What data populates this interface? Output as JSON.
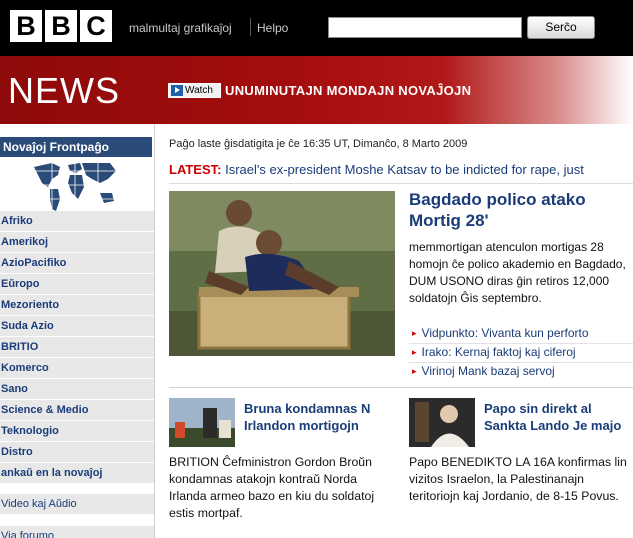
{
  "header": {
    "logo_letters": [
      "B",
      "B",
      "C"
    ],
    "nav": {
      "graphics": "malmultaj grafikaĵoj",
      "help": "Helpo"
    },
    "search": {
      "value": "",
      "button": "Serĉo"
    }
  },
  "banner": {
    "title": "NEWS",
    "watch_label": "Watch",
    "headline": "UNUMINUTAJN MONDAJN NOVAĴOJN",
    "colors": {
      "dark": "#8e0a0a",
      "mid": "#b11818"
    }
  },
  "sidebar": {
    "front_page": "Novaĵoj Frontpaĝo",
    "items": [
      "Afriko",
      "Amerikoj",
      "AzioPacifiko",
      "Eŭropo",
      "Mezoriento",
      "Suda Azio",
      "BRITIO",
      "Komerco",
      "Sano",
      "Science & Medio",
      "Teknologio",
      "Distro",
      "ankaŭ en la novaĵoj"
    ],
    "extra_items": [
      "Video kaj Aŭdio",
      "Via forumo"
    ]
  },
  "main": {
    "updated": "Paĝo laste ĝisdatigita je ĉe 16:35 UT, Dimanĉo, 8 Marto 2009",
    "latest_label": "LATEST:",
    "latest_text": "Israel's ex-president Moshe Katsav to be indicted for rape, just",
    "lead": {
      "title": "Bagdado polico atako Mortig 28'",
      "summary": "memmortigan atenculon mortigas 28 homojn ĉe polico akademio en Bagdado, DUM USONO diras ĝin retiros 12,000 soldatojn Ĝis septembro.",
      "links": [
        "Vidpunkto: Vivanta kun perforto",
        "Irako: Kernaj faktoj kaj ciferoj",
        "Virinoj Mank bazaj servoj"
      ]
    },
    "story2": {
      "title": "Bruna kondamnas N Irlandon mortigojn",
      "summary": "BRITION Ĉefministron Gordon Broŭn kondamnas atakojn kontraŭ Norda Irlanda armeo bazo en kiu du soldatoj estis mortpaf."
    },
    "story3": {
      "title": "Papo sin direkt al Sankta Lando Je majo",
      "summary": "Papo BENEDIKTO LA 16A konfirmas lin vizitos Israelon, la Palestinanajn teritoriojn kaj Jordanio, de 8-15 Povus."
    }
  }
}
